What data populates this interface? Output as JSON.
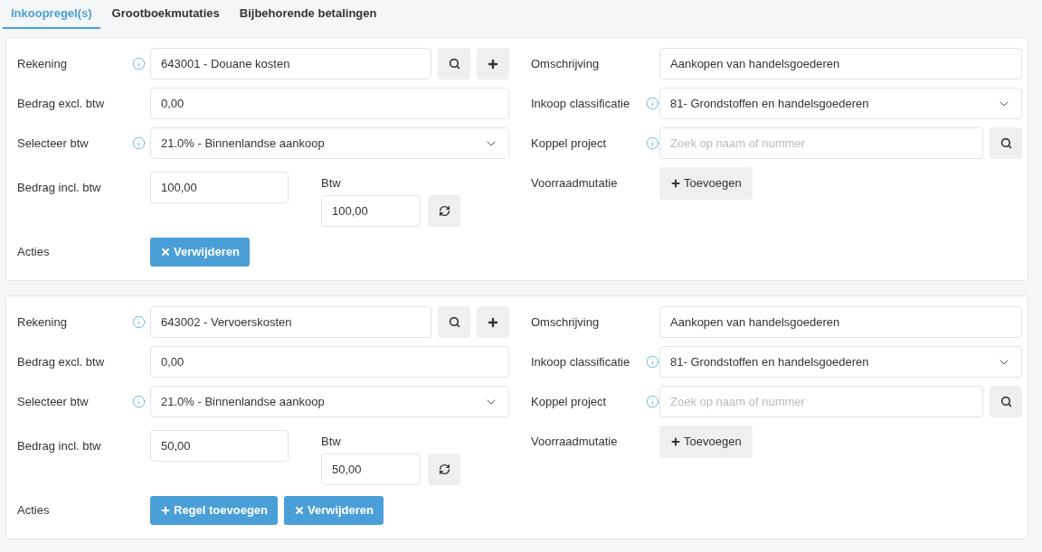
{
  "tabs": [
    {
      "label": "Inkoopregel(s)",
      "selected": true
    },
    {
      "label": "Grootboekmutaties",
      "selected": false
    },
    {
      "label": "Bijbehorende betalingen",
      "selected": false
    }
  ],
  "lines": [
    {
      "rekening": {
        "label": "Rekening",
        "value": "643001 - Douane kosten"
      },
      "bedrag_excl": {
        "label": "Bedrag excl. btw",
        "value": "0,00"
      },
      "selecteer_btw": {
        "label": "Selecteer btw",
        "value": "21.0% - Binnenlandse aankoop"
      },
      "bedrag_incl": {
        "label": "Bedrag incl. btw",
        "value": "100,00"
      },
      "btw": {
        "label": "Btw",
        "value": "100,00"
      },
      "acties": {
        "label": "Acties",
        "buttons": [
          {
            "kind": "remove",
            "label": "Verwijderen"
          }
        ]
      },
      "omschrijving": {
        "label": "Omschrijving",
        "value": "Aankopen van handelsgoederen"
      },
      "inkoop_classificatie": {
        "label": "Inkoop classificatie",
        "value": "81- Grondstoffen en handelsgoederen"
      },
      "koppel_project": {
        "label": "Koppel project",
        "placeholder": "Zoek op naam of nummer"
      },
      "voorraadmutatie": {
        "label": "Voorraadmutatie",
        "button": "Toevoegen"
      }
    },
    {
      "rekening": {
        "label": "Rekening",
        "value": "643002 - Vervoerskosten"
      },
      "bedrag_excl": {
        "label": "Bedrag excl. btw",
        "value": "0,00"
      },
      "selecteer_btw": {
        "label": "Selecteer btw",
        "value": "21.0% - Binnenlandse aankoop"
      },
      "bedrag_incl": {
        "label": "Bedrag incl. btw",
        "value": "50,00"
      },
      "btw": {
        "label": "Btw",
        "value": "50,00"
      },
      "acties": {
        "label": "Acties",
        "buttons": [
          {
            "kind": "add",
            "label": "Regel toevoegen"
          },
          {
            "kind": "remove",
            "label": "Verwijderen"
          }
        ]
      },
      "omschrijving": {
        "label": "Omschrijving",
        "value": "Aankopen van handelsgoederen"
      },
      "inkoop_classificatie": {
        "label": "Inkoop classificatie",
        "value": "81- Grondstoffen en handelsgoederen"
      },
      "koppel_project": {
        "label": "Koppel project",
        "placeholder": "Zoek op naam of nummer"
      },
      "voorraadmutatie": {
        "label": "Voorraadmutatie",
        "button": "Toevoegen"
      }
    }
  ]
}
